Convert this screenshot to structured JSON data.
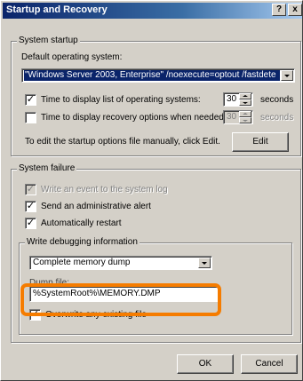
{
  "window": {
    "title": "Startup and Recovery",
    "help_btn": "?",
    "close_btn": "x"
  },
  "system_startup": {
    "legend": "System startup",
    "default_os_label": "Default operating system:",
    "default_os_value": "\"Windows Server 2003, Enterprise\" /noexecute=optout /fastdete",
    "time_list_label": "Time to display list of operating systems:",
    "time_list_checked": true,
    "time_list_value": "30",
    "time_list_units": "seconds",
    "time_recovery_label": "Time to display recovery options when needed:",
    "time_recovery_checked": false,
    "time_recovery_value": "30",
    "time_recovery_units": "seconds",
    "edit_hint": "To edit the startup options file manually, click Edit.",
    "edit_button": "Edit"
  },
  "system_failure": {
    "legend": "System failure",
    "write_event_label": "Write an event to the system log",
    "write_event_checked": true,
    "send_alert_label": "Send an administrative alert",
    "send_alert_checked": true,
    "auto_restart_label": "Automatically restart",
    "auto_restart_checked": true
  },
  "debugging": {
    "legend": "Write debugging information",
    "dump_type": "Complete memory dump",
    "dump_file_label": "Dump file:",
    "dump_file_value": "%SystemRoot%\\MEMORY.DMP",
    "overwrite_label": "Overwrite any existing file",
    "overwrite_checked": true
  },
  "footer": {
    "ok_button": "OK",
    "cancel_button": "Cancel"
  },
  "colors": {
    "dialog_bg": "#d4d0c8",
    "titlebar": "#0a246a",
    "highlight_ring": "#f57c00"
  }
}
